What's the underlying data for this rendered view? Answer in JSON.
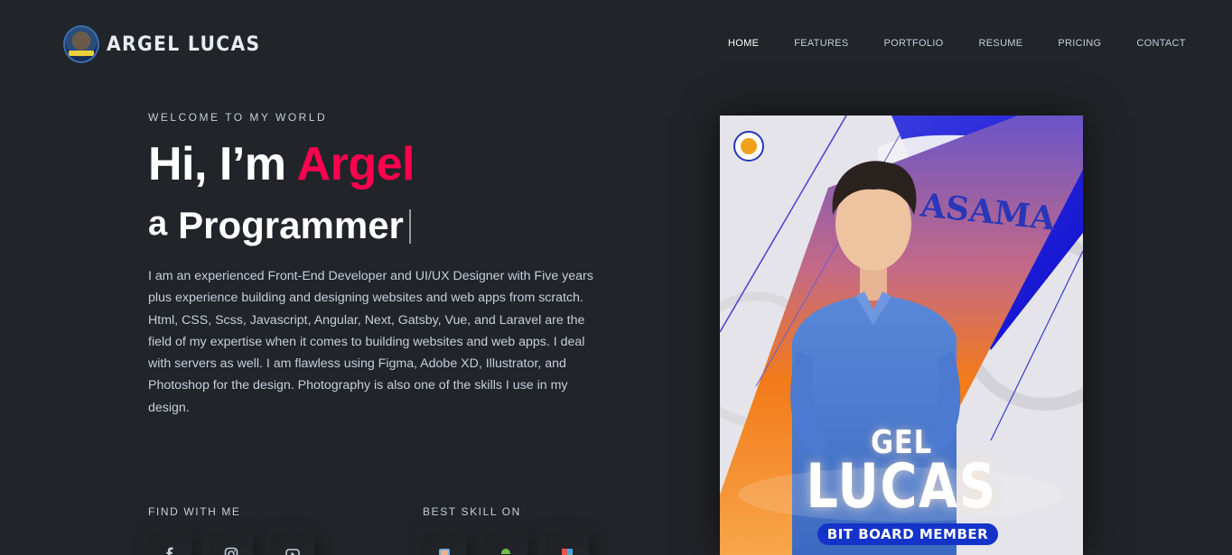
{
  "brand": {
    "name": "ARGEL LUCAS",
    "logo_icon": "profile-logo-icon"
  },
  "nav": {
    "items": [
      {
        "label": "HOME",
        "active": true
      },
      {
        "label": "FEATURES",
        "active": false
      },
      {
        "label": "PORTFOLIO",
        "active": false
      },
      {
        "label": "RESUME",
        "active": false
      },
      {
        "label": "PRICING",
        "active": false
      },
      {
        "label": "CONTACT",
        "active": false
      }
    ]
  },
  "hero": {
    "welcome": "WELCOME TO MY WORLD",
    "greeting": "Hi, I’m ",
    "name": "Argel",
    "role_prefix": "a",
    "role": "Programmer",
    "description": "I am an experienced Front-End Developer and UI/UX Designer with Five years plus experience building and designing websites and web apps from scratch. Html, CSS, Scss, Javascript, Angular, Next, Gatsby, Vue, and Laravel are the field of my expertise when it comes to building websites and web apps. I deal with servers as well. I am flawless using Figma, Adobe XD, Illustrator, and Photoshop for the design. Photography is also one of the skills I use in my design.",
    "find_label": "FIND WITH ME",
    "skill_label": "BEST SKILL ON",
    "social_icons": [
      "facebook-icon",
      "instagram-icon",
      "youtube-icon"
    ],
    "skill_icons": [
      "figma-icon",
      "android-icon",
      "figma-alt-icon"
    ]
  },
  "poster": {
    "flag_text": "ASAMA",
    "title_top": "GEL",
    "title_bottom": "LUCAS",
    "badge": "BIT BOARD MEMBER"
  },
  "colors": {
    "background": "#212428",
    "accent": "#ff014f",
    "text": "#c4cfde",
    "poster_blue": "#1433c9",
    "poster_orange": "#f27a1a"
  }
}
